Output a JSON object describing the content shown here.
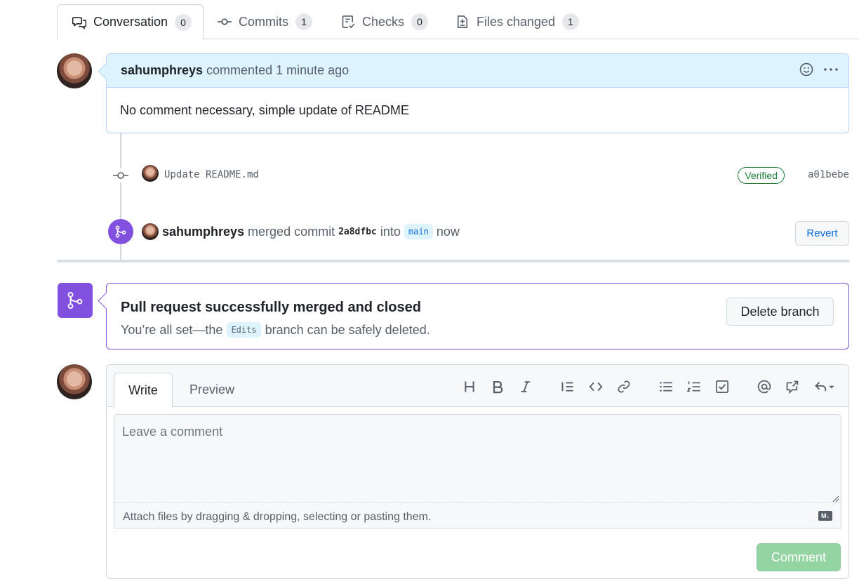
{
  "tabs": [
    {
      "label": "Conversation",
      "count": "0",
      "icon": "comment-discussion-icon"
    },
    {
      "label": "Commits",
      "count": "1",
      "icon": "git-commit-icon"
    },
    {
      "label": "Checks",
      "count": "0",
      "icon": "checklist-icon"
    },
    {
      "label": "Files changed",
      "count": "1",
      "icon": "file-diff-icon"
    }
  ],
  "comment": {
    "author": "sahumphreys",
    "meta": "commented 1 minute ago",
    "body": "No comment necessary, simple update of README"
  },
  "commit": {
    "message": "Update README.md",
    "verified": "Verified",
    "sha": "a01bebe"
  },
  "merge_event": {
    "author": "sahumphreys",
    "action": "merged commit",
    "commit": "2a8dfbc",
    "into": "into",
    "branch": "main",
    "time": "now",
    "revert_label": "Revert"
  },
  "merged_status": {
    "title": "Pull request successfully merged and closed",
    "sub_before": "You’re all set—the",
    "branch": "Edits",
    "sub_after": "branch can be safely deleted.",
    "delete_label": "Delete branch"
  },
  "compose": {
    "write_tab": "Write",
    "preview_tab": "Preview",
    "placeholder": "Leave a comment",
    "attach_text": "Attach files by dragging & dropping, selecting or pasting them.",
    "markdown_badge": "M↓",
    "submit_label": "Comment"
  },
  "colors": {
    "merged_purple": "#8250df",
    "link_blue": "#0969da",
    "verified_green": "#1a7f37",
    "comment_disabled_green": "#94d3a2"
  }
}
